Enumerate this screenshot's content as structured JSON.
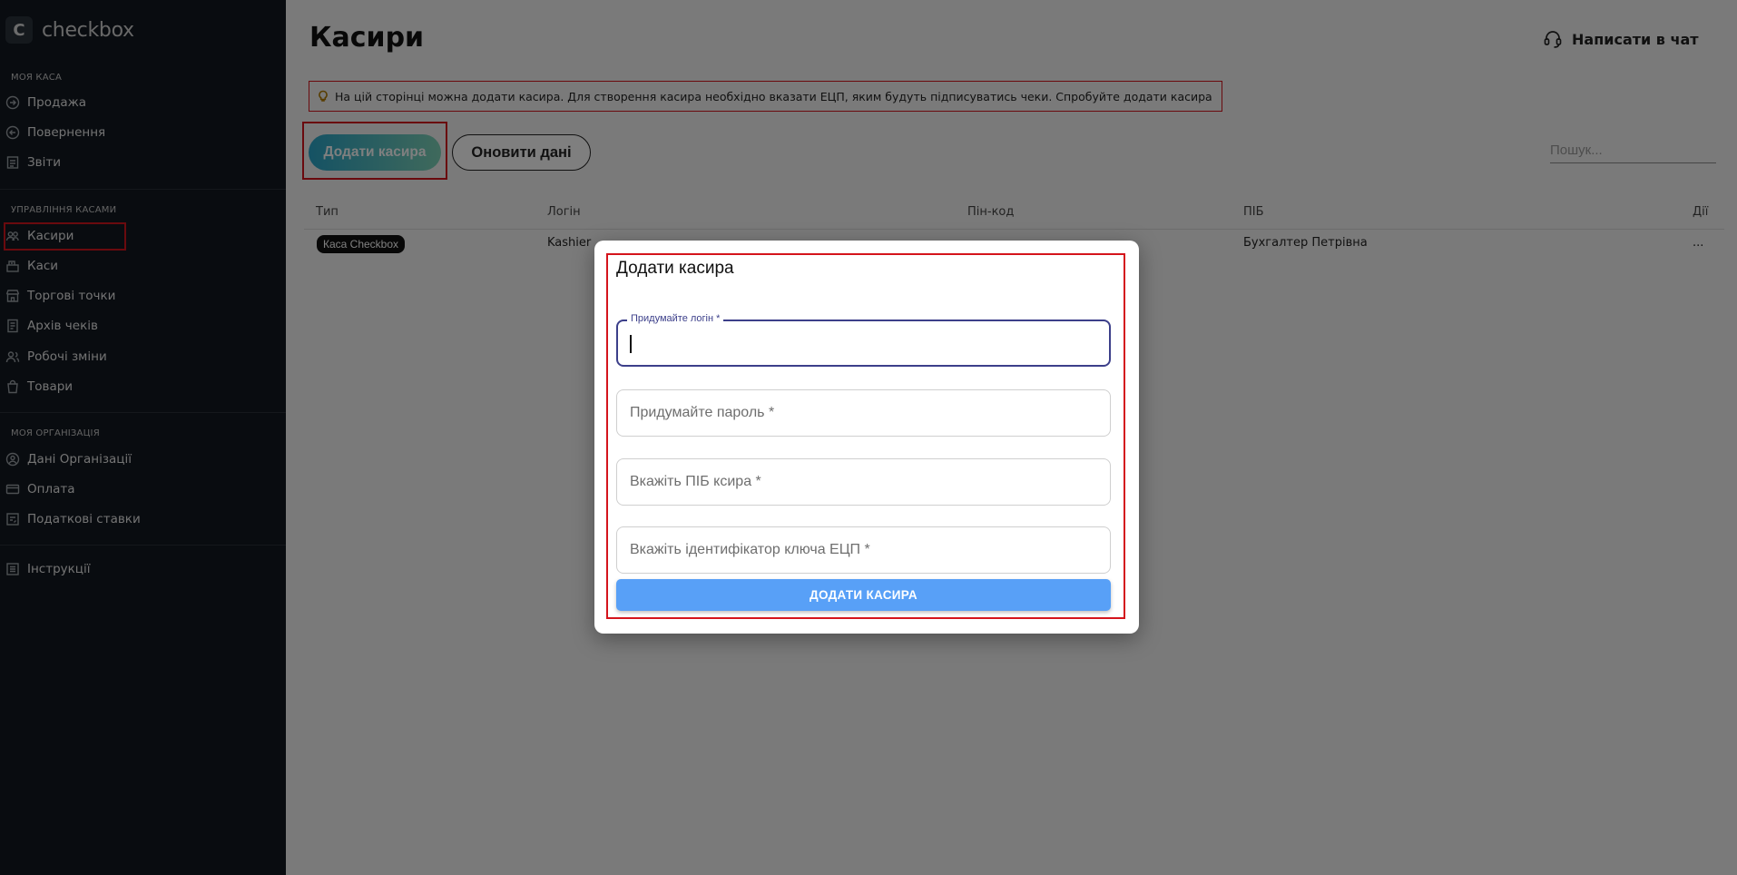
{
  "sidebar": {
    "logo_letter": "C",
    "logo_text": "checkbox",
    "sections": [
      {
        "title": "МОЯ КАСА",
        "items": [
          {
            "label": "Продажа",
            "icon": "arrow-right-circle-icon"
          },
          {
            "label": "Повернення",
            "icon": "arrow-left-circle-icon"
          },
          {
            "label": "Звіти",
            "icon": "report-icon"
          }
        ]
      },
      {
        "title": "УПРАВЛІННЯ КАСАМИ",
        "items": [
          {
            "label": "Касири",
            "icon": "users-icon",
            "active": true
          },
          {
            "label": "Каси",
            "icon": "cash-register-icon"
          },
          {
            "label": "Торгові точки",
            "icon": "store-icon"
          },
          {
            "label": "Архів чеків",
            "icon": "receipt-archive-icon"
          },
          {
            "label": "Робочі зміни",
            "icon": "people-icon"
          },
          {
            "label": "Товари",
            "icon": "shopping-bag-icon"
          }
        ]
      },
      {
        "title": "МОЯ ОРГАНІЗАЦІЯ",
        "items": [
          {
            "label": "Дані Організації",
            "icon": "organization-icon"
          },
          {
            "label": "Оплата",
            "icon": "credit-card-icon"
          },
          {
            "label": "Податкові ставки",
            "icon": "tax-icon"
          }
        ]
      },
      {
        "title": "",
        "items": [
          {
            "label": "Інструкції",
            "icon": "list-icon"
          }
        ]
      }
    ]
  },
  "header": {
    "title": "Касири",
    "chat_label": "Написати в чат",
    "chat_icon": "headset-icon"
  },
  "info_banner": {
    "icon": "lightbulb-icon",
    "text": "На цій сторінці можна додати касира. Для створення касира необхідно вказати ЕЦП, яким будуть підписуватись чеки. Спробуйте додати касира"
  },
  "toolbar": {
    "add_label": "Додати касира",
    "refresh_label": "Оновити дані",
    "search_placeholder": "Пошук..."
  },
  "table": {
    "columns": [
      "Тип",
      "Логін",
      "Пін-код",
      "ПІБ",
      "Дії"
    ],
    "rows": [
      {
        "type": "Каса Checkbox",
        "login": "Kashier",
        "pin": "",
        "name": "Бухгалтер Петрівна",
        "actions": "..."
      }
    ]
  },
  "modal": {
    "title": "Додати касира",
    "fields": [
      {
        "label": "Придумайте логін *",
        "placeholder": "",
        "value": ""
      },
      {
        "label": "",
        "placeholder": "Придумайте пароль *",
        "value": ""
      },
      {
        "label": "",
        "placeholder": "Вкажіть ПІБ ксира *",
        "value": ""
      },
      {
        "label": "",
        "placeholder": "Вкажіть ідентифікатор ключа ЕЦП *",
        "value": ""
      }
    ],
    "submit_label": "ДОДАТИ КАСИРА"
  },
  "colors": {
    "sidebar_bg": "#121820",
    "highlight_red": "#d4141c",
    "focus_indigo": "#3c3f8a",
    "submit_blue": "#58a0f7"
  }
}
